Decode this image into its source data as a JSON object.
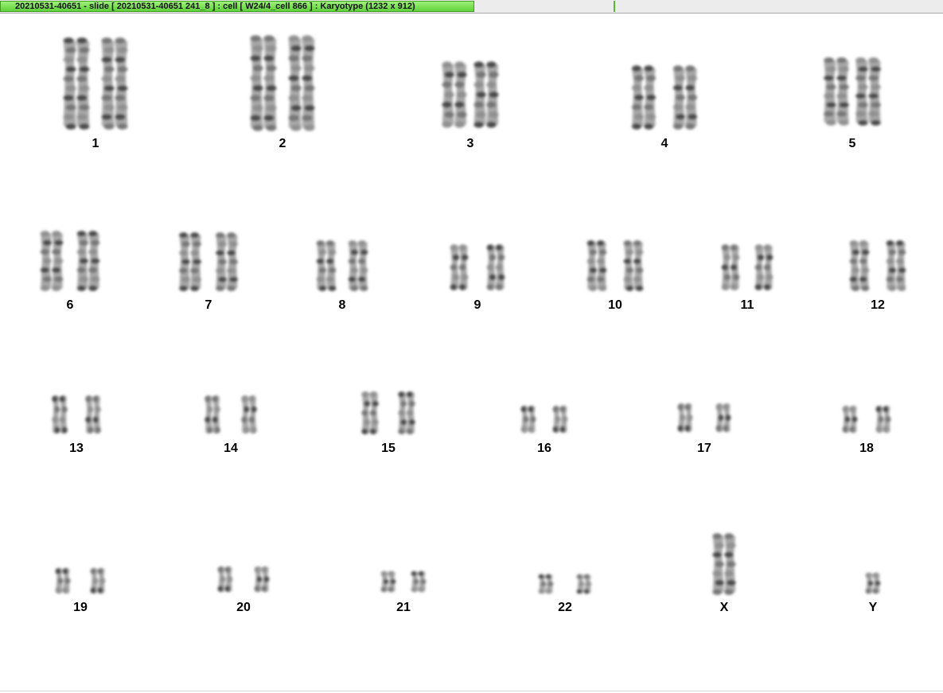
{
  "window": {
    "title": "20210531-40651 - slide [ 20210531-40651 241_8 ] : cell [ W24/4_cell 866 ] : Karyotype  (1232 x 912)"
  },
  "karyotype": {
    "pairs": [
      {
        "label": "1"
      },
      {
        "label": "2"
      },
      {
        "label": "3"
      },
      {
        "label": "4"
      },
      {
        "label": "5"
      },
      {
        "label": "6"
      },
      {
        "label": "7"
      },
      {
        "label": "8"
      },
      {
        "label": "9"
      },
      {
        "label": "10"
      },
      {
        "label": "11"
      },
      {
        "label": "12"
      },
      {
        "label": "13"
      },
      {
        "label": "14"
      },
      {
        "label": "15"
      },
      {
        "label": "16"
      },
      {
        "label": "17"
      },
      {
        "label": "18"
      },
      {
        "label": "19"
      },
      {
        "label": "20"
      },
      {
        "label": "21"
      },
      {
        "label": "22"
      },
      {
        "label": "X"
      },
      {
        "label": "Y"
      }
    ]
  }
}
